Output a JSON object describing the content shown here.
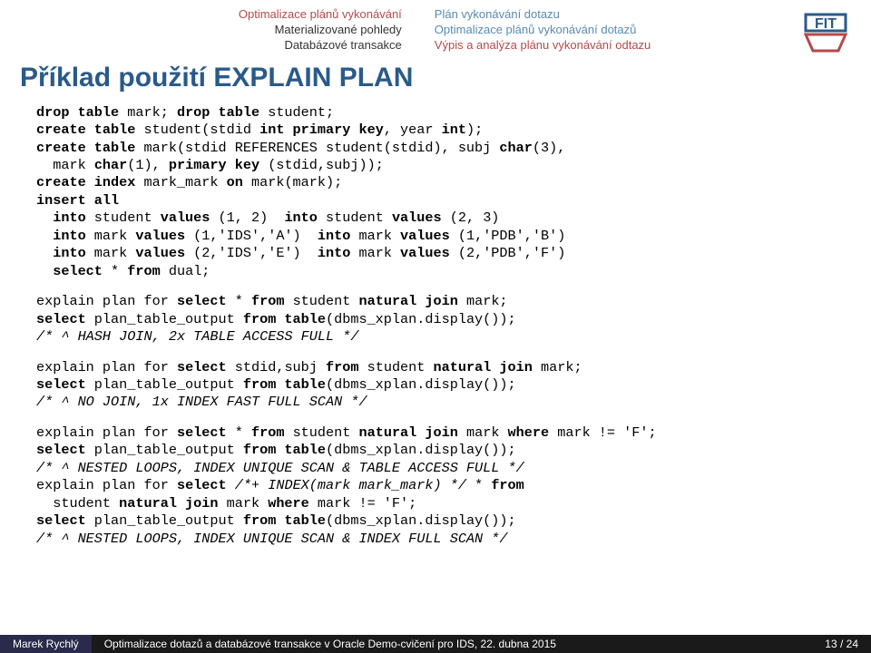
{
  "header": {
    "left": [
      "Optimalizace plánů vykonávání",
      "Materializované pohledy",
      "Databázové transakce"
    ],
    "right": [
      "Plán vykonávání dotazu",
      "Optimalizace plánů vykonávání dotazů",
      "Výpis a analýza plánu vykonávání odtazu"
    ],
    "left_active_index": 0,
    "right_active_index": 2
  },
  "title": "Příklad použití EXPLAIN PLAN",
  "code": {
    "block1": [
      {
        "t": "drop table",
        "b": true
      },
      {
        "t": " mark; "
      },
      {
        "t": "drop table",
        "b": true
      },
      {
        "t": " student;\n"
      },
      {
        "t": "create table",
        "b": true
      },
      {
        "t": " student(stdid "
      },
      {
        "t": "int primary key",
        "b": true
      },
      {
        "t": ", year "
      },
      {
        "t": "int",
        "b": true
      },
      {
        "t": ");\n"
      },
      {
        "t": "create table",
        "b": true
      },
      {
        "t": " mark(stdid REFERENCES student(stdid), subj "
      },
      {
        "t": "char",
        "b": true
      },
      {
        "t": "(3),\n"
      },
      {
        "t": "  mark "
      },
      {
        "t": "char",
        "b": true
      },
      {
        "t": "(1), "
      },
      {
        "t": "primary key",
        "b": true
      },
      {
        "t": " (stdid,subj));\n"
      },
      {
        "t": "create index",
        "b": true
      },
      {
        "t": " mark_mark "
      },
      {
        "t": "on",
        "b": true
      },
      {
        "t": " mark(mark);\n"
      },
      {
        "t": "insert all",
        "b": true
      },
      {
        "t": "\n"
      },
      {
        "t": "  into",
        "b": true
      },
      {
        "t": " student "
      },
      {
        "t": "values",
        "b": true
      },
      {
        "t": " (1, 2)  "
      },
      {
        "t": "into",
        "b": true
      },
      {
        "t": " student "
      },
      {
        "t": "values",
        "b": true
      },
      {
        "t": " (2, 3)\n"
      },
      {
        "t": "  into",
        "b": true
      },
      {
        "t": " mark "
      },
      {
        "t": "values",
        "b": true
      },
      {
        "t": " (1,'IDS','A')  "
      },
      {
        "t": "into",
        "b": true
      },
      {
        "t": " mark "
      },
      {
        "t": "values",
        "b": true
      },
      {
        "t": " (1,'PDB','B')\n"
      },
      {
        "t": "  into",
        "b": true
      },
      {
        "t": " mark "
      },
      {
        "t": "values",
        "b": true
      },
      {
        "t": " (2,'IDS','E')  "
      },
      {
        "t": "into",
        "b": true
      },
      {
        "t": " mark "
      },
      {
        "t": "values",
        "b": true
      },
      {
        "t": " (2,'PDB','F')\n"
      },
      {
        "t": "  select",
        "b": true
      },
      {
        "t": " * "
      },
      {
        "t": "from",
        "b": true
      },
      {
        "t": " dual;"
      }
    ],
    "block2": [
      {
        "t": "explain plan for "
      },
      {
        "t": "select",
        "b": true
      },
      {
        "t": " * "
      },
      {
        "t": "from",
        "b": true
      },
      {
        "t": " student "
      },
      {
        "t": "natural join",
        "b": true
      },
      {
        "t": " mark;\n"
      },
      {
        "t": "select",
        "b": true
      },
      {
        "t": " plan_table_output "
      },
      {
        "t": "from table",
        "b": true
      },
      {
        "t": "(dbms_xplan.display());\n"
      },
      {
        "t": "/* ^ HASH JOIN, 2x TABLE ACCESS FULL */",
        "i": true
      }
    ],
    "block3": [
      {
        "t": "explain plan for "
      },
      {
        "t": "select",
        "b": true
      },
      {
        "t": " stdid,subj "
      },
      {
        "t": "from",
        "b": true
      },
      {
        "t": " student "
      },
      {
        "t": "natural join",
        "b": true
      },
      {
        "t": " mark;\n"
      },
      {
        "t": "select",
        "b": true
      },
      {
        "t": " plan_table_output "
      },
      {
        "t": "from table",
        "b": true
      },
      {
        "t": "(dbms_xplan.display());\n"
      },
      {
        "t": "/* ^ NO JOIN, 1x INDEX FAST FULL SCAN */",
        "i": true
      }
    ],
    "block4": [
      {
        "t": "explain plan for "
      },
      {
        "t": "select",
        "b": true
      },
      {
        "t": " * "
      },
      {
        "t": "from",
        "b": true
      },
      {
        "t": " student "
      },
      {
        "t": "natural join",
        "b": true
      },
      {
        "t": " mark "
      },
      {
        "t": "where",
        "b": true
      },
      {
        "t": " mark != 'F';\n"
      },
      {
        "t": "select",
        "b": true
      },
      {
        "t": " plan_table_output "
      },
      {
        "t": "from table",
        "b": true
      },
      {
        "t": "(dbms_xplan.display());\n"
      },
      {
        "t": "/* ^ NESTED LOOPS, INDEX UNIQUE SCAN & TABLE ACCESS FULL */",
        "i": true
      },
      {
        "t": "\n"
      },
      {
        "t": "explain plan for "
      },
      {
        "t": "select",
        "b": true
      },
      {
        "t": " "
      },
      {
        "t": "/*+ INDEX(mark mark_mark) */",
        "i": true
      },
      {
        "t": " * "
      },
      {
        "t": "from",
        "b": true
      },
      {
        "t": "\n"
      },
      {
        "t": "  student "
      },
      {
        "t": "natural join",
        "b": true
      },
      {
        "t": " mark "
      },
      {
        "t": "where",
        "b": true
      },
      {
        "t": " mark != 'F';\n"
      },
      {
        "t": "select",
        "b": true
      },
      {
        "t": " plan_table_output "
      },
      {
        "t": "from table",
        "b": true
      },
      {
        "t": "(dbms_xplan.display());\n"
      },
      {
        "t": "/* ^ NESTED LOOPS, INDEX UNIQUE SCAN & INDEX FULL SCAN */",
        "i": true
      }
    ]
  },
  "footer": {
    "author": "Marek Rychlý",
    "title": "Optimalizace dotazů a databázové transakce v Oracle   Demo-cvičení pro IDS, 22. dubna 2015",
    "page": "13 / 24"
  },
  "logo": {
    "text": "FIT",
    "color_top": "#2a5a8a",
    "color_bottom": "#b44a4a"
  }
}
